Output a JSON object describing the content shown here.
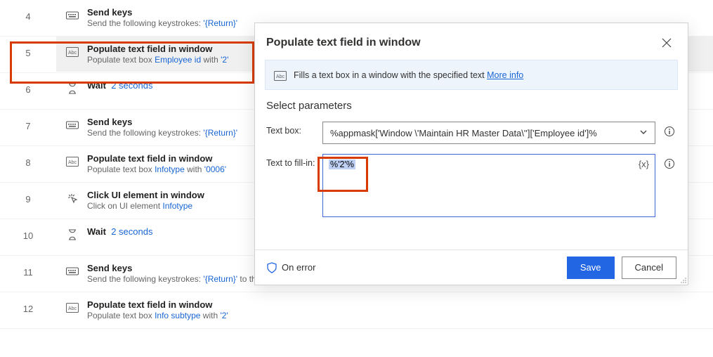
{
  "steps": [
    {
      "num": "4",
      "icon": "keyboard",
      "title": "Send keys",
      "sub_pre": "Send the following keystrokes: ",
      "sub_link": "'{Return}'",
      "sub_post": ""
    },
    {
      "num": "5",
      "icon": "abc",
      "title": "Populate text field in window",
      "sub_pre": "Populate text box ",
      "sub_link": "Employee id",
      "sub_post": " with ",
      "sub_val": "'2'",
      "selected": true
    },
    {
      "num": "6",
      "icon": "hourglass",
      "title": "Wait",
      "inline_val": "2 seconds"
    },
    {
      "num": "7",
      "icon": "keyboard",
      "title": "Send keys",
      "sub_pre": "Send the following keystrokes: ",
      "sub_link": "'{Return}'",
      "sub_post": ""
    },
    {
      "num": "8",
      "icon": "abc",
      "title": "Populate text field in window",
      "sub_pre": "Populate text box ",
      "sub_link": "Infotype",
      "sub_post": " with ",
      "sub_val": "'0006'"
    },
    {
      "num": "9",
      "icon": "click",
      "title": "Click UI element in window",
      "sub_pre": "Click on UI element ",
      "sub_link": "Infotype",
      "sub_post": ""
    },
    {
      "num": "10",
      "icon": "hourglass",
      "title": "Wait",
      "inline_val": "2 seconds"
    },
    {
      "num": "11",
      "icon": "keyboard",
      "title": "Send keys",
      "sub_pre": "Send the following keystrokes: ",
      "sub_link": "'{Return}'",
      "sub_post": " to the active window"
    },
    {
      "num": "12",
      "icon": "abc",
      "title": "Populate text field in window",
      "sub_pre": "Populate text box ",
      "sub_link": "Info subtype",
      "sub_post": " with ",
      "sub_val": "'2'"
    }
  ],
  "panel": {
    "title": "Populate text field in window",
    "banner_text": "Fills a text box in a window with the specified text ",
    "banner_more": "More info",
    "section": "Select parameters",
    "textbox_label": "Text box:",
    "textbox_value": "%appmask['Window \\'Maintain HR Master Data\\'']['Employee id']%",
    "fillin_label": "Text to fill-in:",
    "fillin_value": "%'2'%",
    "fx_label": "{x}",
    "on_error": "On error",
    "save": "Save",
    "cancel": "Cancel"
  }
}
